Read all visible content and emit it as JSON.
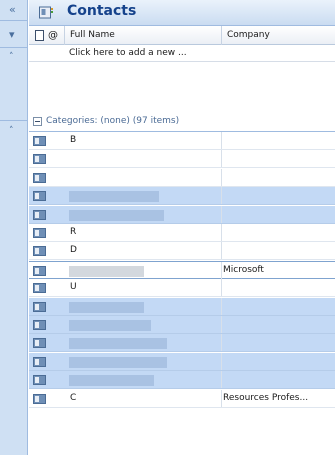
{
  "header": {
    "title": "Contacts",
    "icon": "contacts-icon"
  },
  "columns": [
    {
      "label": "",
      "icon": "item-icon-column"
    },
    {
      "label": "",
      "icon": "attachment-column-icon"
    },
    {
      "label": "Full Name"
    },
    {
      "label": "Company"
    }
  ],
  "new_item": {
    "placeholder": "Click here to add a new ..."
  },
  "group": {
    "label": "Categories: (none) (97 items)",
    "expanded": true
  },
  "rows": [
    {
      "name": "B",
      "company": "",
      "selected": false
    },
    {
      "name": "",
      "company": "",
      "selected": false
    },
    {
      "name": "",
      "company": "",
      "selected": false
    },
    {
      "name": "",
      "company": "",
      "selected": true,
      "redacted": true
    },
    {
      "name": "",
      "company": "",
      "selected": true,
      "redacted": true
    },
    {
      "name": "R",
      "company": "",
      "selected": false
    },
    {
      "name": "D",
      "company": "",
      "selected": false
    },
    {
      "name": "",
      "company": "Microsoft",
      "selected": false,
      "focused": true,
      "redacted": true
    },
    {
      "name": "U",
      "company": "",
      "selected": false
    },
    {
      "name": "",
      "company": "",
      "selected": true,
      "redacted": true
    },
    {
      "name": "",
      "company": "",
      "selected": true,
      "redacted": true
    },
    {
      "name": "",
      "company": "",
      "selected": true,
      "redacted": true
    },
    {
      "name": "",
      "company": "",
      "selected": true,
      "redacted": true
    },
    {
      "name": "",
      "company": "",
      "selected": true,
      "redacted": true
    },
    {
      "name": "C",
      "company": "Resources Profes...",
      "selected": false
    }
  ],
  "nav": {
    "icons": [
      "collapse-chevron-icon",
      "expand-chevron-icon",
      "expand-chevron-icon"
    ]
  },
  "colors": {
    "accent": "#15428b",
    "selection": "#c3d9f5",
    "header_bg": "#cadcf1"
  }
}
